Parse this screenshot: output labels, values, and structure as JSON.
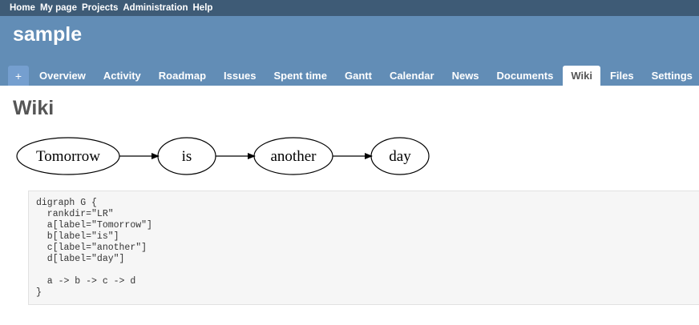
{
  "top_menu": {
    "items": [
      "Home",
      "My page",
      "Projects",
      "Administration",
      "Help"
    ]
  },
  "project": {
    "title": "sample"
  },
  "main_menu": {
    "new_label": "+",
    "tabs": [
      "Overview",
      "Activity",
      "Roadmap",
      "Issues",
      "Spent time",
      "Gantt",
      "Calendar",
      "News",
      "Documents",
      "Wiki",
      "Files",
      "Settings"
    ],
    "selected": "Wiki"
  },
  "page": {
    "heading": "Wiki"
  },
  "graph": {
    "nodes": [
      "Tomorrow",
      "is",
      "another",
      "day"
    ],
    "edges": [
      [
        "Tomorrow",
        "is"
      ],
      [
        "is",
        "another"
      ],
      [
        "another",
        "day"
      ]
    ]
  },
  "code": {
    "text": "digraph G {\n  rankdir=\"LR\"\n  a[label=\"Tomorrow\"]\n  b[label=\"is\"]\n  c[label=\"another\"]\n  d[label=\"day\"]\n\n  a -> b -> c -> d\n}"
  },
  "colors": {
    "top_menu_bg": "#3e5b76",
    "header_bg": "#628db6",
    "tab_selected_bg": "#ffffff",
    "code_bg": "#f6f6f6"
  }
}
